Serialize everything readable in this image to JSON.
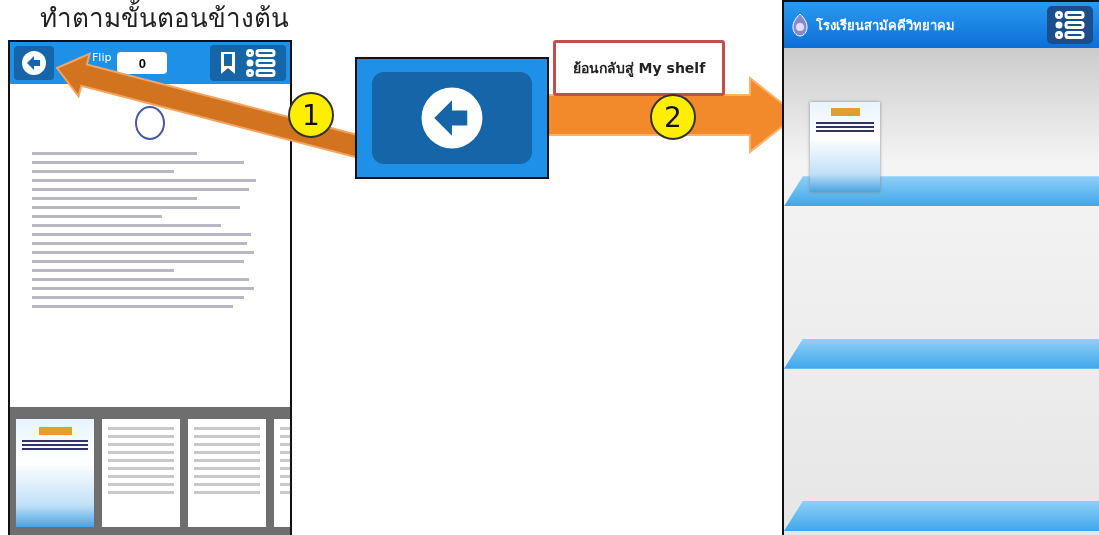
{
  "title": "ทำตามขั้นตอนข้างต้น",
  "reader": {
    "label": "Flip",
    "page_field": {
      "value": "0"
    },
    "thumbnails": [
      {
        "kind": "cover"
      },
      {
        "kind": "page"
      },
      {
        "kind": "page"
      },
      {
        "kind": "page"
      }
    ]
  },
  "steps": [
    {
      "number": "1"
    },
    {
      "number": "2"
    }
  ],
  "callout": "ย้อนกลับสู่ My shelf",
  "shelf": {
    "school_name": "โรงเรียนสามัคคีวิทยาคม",
    "books": [
      {
        "kind": "cover"
      }
    ]
  }
}
